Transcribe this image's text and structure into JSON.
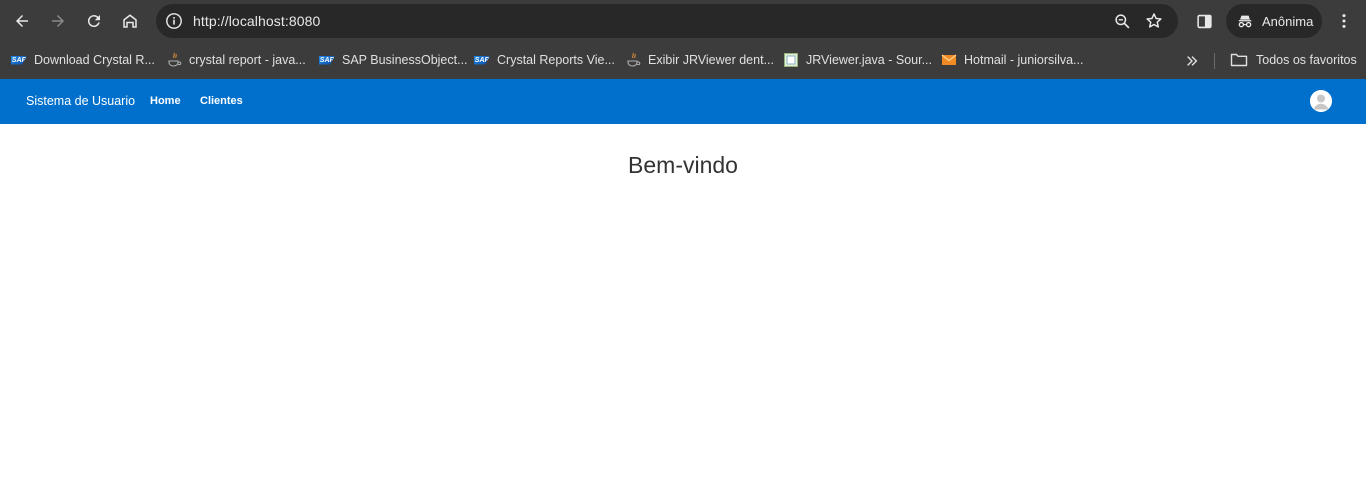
{
  "browser": {
    "url": "http://localhost:8080",
    "profile_label": "Anônima",
    "icons": {
      "back": "back-arrow-icon",
      "forward": "forward-arrow-icon",
      "reload": "reload-icon",
      "home": "home-icon",
      "site_info": "info-icon",
      "zoom": "zoom-icon",
      "bookmark": "star-icon",
      "side_panel": "side-panel-icon",
      "incognito": "incognito-icon",
      "menu": "kebab-menu-icon"
    }
  },
  "bookmarks": {
    "items": [
      {
        "label": "Download Crystal R...",
        "icon": "sap-icon"
      },
      {
        "label": "crystal report - java...",
        "icon": "java-icon"
      },
      {
        "label": "SAP BusinessObject...",
        "icon": "sap-icon"
      },
      {
        "label": "Crystal Reports Vie...",
        "icon": "sap-icon"
      },
      {
        "label": "Exibir JRViewer dent...",
        "icon": "java-icon"
      },
      {
        "label": "JRViewer.java - Sour...",
        "icon": "document-icon"
      },
      {
        "label": "Hotmail - juniorsilva...",
        "icon": "mail-icon"
      }
    ],
    "all_bookmarks_label": "Todos os favoritos"
  },
  "app": {
    "brand": "Sistema de Usuario",
    "nav": [
      {
        "label": "Home"
      },
      {
        "label": "Clientes"
      }
    ]
  },
  "main": {
    "title": "Bem-vindo"
  },
  "colors": {
    "browser_chrome": "#3c3c3c",
    "omnibox": "#282828",
    "navbar": "#0070cc",
    "heading_text": "#333333"
  }
}
